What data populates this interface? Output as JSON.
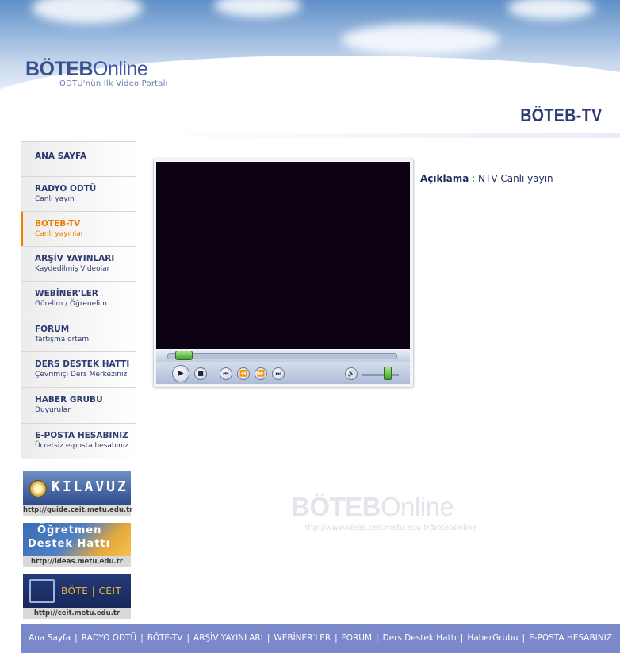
{
  "header": {
    "logo_bold": "BÖTEB",
    "logo_light": "Online",
    "tagline": "ODTÜ'nün İlk Video Portalı",
    "section_title": "BÖTEB-TV"
  },
  "sidebar": {
    "items": [
      {
        "label": "ANA SAYFA",
        "sub": ""
      },
      {
        "label": "RADYO ODTÜ",
        "sub": "Canlı yayın"
      },
      {
        "label": "BOTEB-TV",
        "sub": "Canlı yayınlar",
        "active": true
      },
      {
        "label": "ARŞİV YAYINLARI",
        "sub": "Kaydedilmiş Videolar"
      },
      {
        "label": "WEBİNER'LER",
        "sub": "Görelim / Öğrenelim"
      },
      {
        "label": "FORUM",
        "sub": "Tartışma ortamı"
      },
      {
        "label": "DERS DESTEK HATTI",
        "sub": "Çevrimiçi Ders Merkeziniz"
      },
      {
        "label": "HABER GRUBU",
        "sub": "Duyurular"
      },
      {
        "label": "E-POSTA HESABINIZ",
        "sub": "Ücretsiz e-posta hesabınız"
      }
    ],
    "banners": [
      {
        "text": "KILAVUZ",
        "url": "http://guide.ceit.metu.edu.tr"
      },
      {
        "text_line1": "Öğretmen",
        "text_line2": "Destek Hattı",
        "url": "http://ideas.metu.edu.tr"
      },
      {
        "text": "BÖTE | CEIT",
        "url": "http://ceit.metu.edu.tr"
      }
    ]
  },
  "player": {
    "seek_fraction": 0.05,
    "volume_fraction": 0.7
  },
  "description": {
    "label": "Açıklama",
    "separator": ":",
    "value": "NTV Canlı yayın"
  },
  "watermark": {
    "logo_bold": "BÖTEB",
    "logo_light": "Online",
    "url": "http://www.ideas.ceit.metu.edu.tr/botebonline"
  },
  "footer": {
    "links": [
      "Ana Sayfa",
      "RADYO ODTÜ",
      "BÖTE-TV",
      "ARŞİV YAYINLARI",
      "WEBİNER'LER",
      "FORUM",
      "Ders Destek Hattı",
      "HaberGrubu",
      "E-POSTA HESABINIZ"
    ],
    "separator": "|"
  },
  "colors": {
    "nav_text": "#2c3b72",
    "active": "#f07c00",
    "footer_bg": "#7b88c9",
    "video_bg": "#0d0214"
  }
}
